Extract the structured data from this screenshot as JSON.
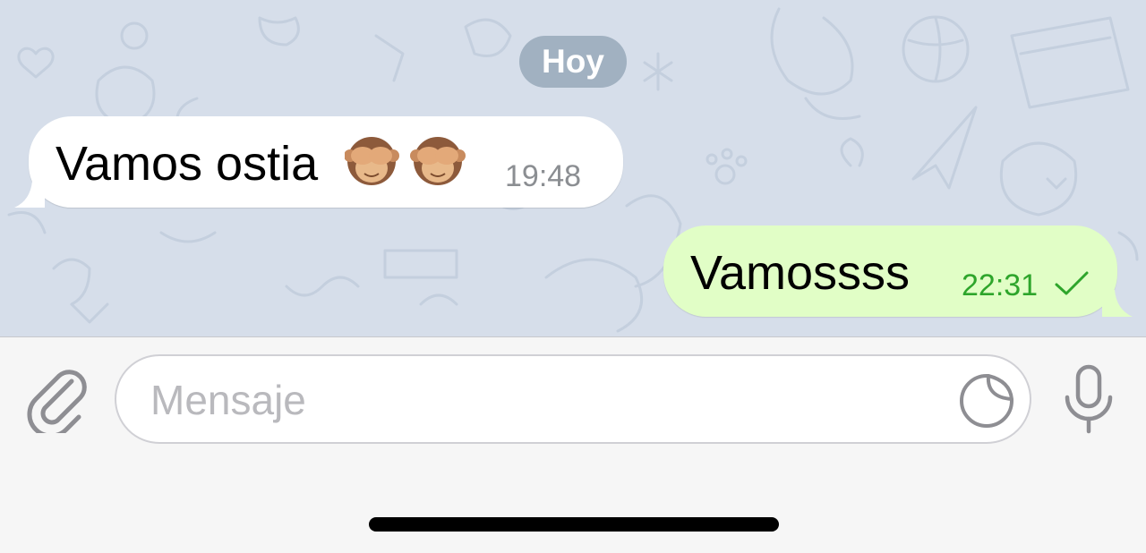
{
  "date_separator": "Hoy",
  "messages": [
    {
      "direction": "incoming",
      "text": "Vamos ostia",
      "emojis": [
        "see-no-evil-monkey",
        "see-no-evil-monkey"
      ],
      "time": "19:48"
    },
    {
      "direction": "outgoing",
      "text": "Vamossss",
      "time": "22:31",
      "status": "sent-checkmark"
    }
  ],
  "composer": {
    "placeholder": "Mensaje",
    "value": "",
    "attach_icon": "paperclip-icon",
    "sticker_icon": "sticker-icon",
    "mic_icon": "microphone-icon"
  },
  "colors": {
    "chat_background": "#d6deea",
    "incoming_bubble": "#ffffff",
    "outgoing_bubble": "#e1fec6",
    "outgoing_time": "#2ea52b",
    "incoming_time": "#8b8e92",
    "date_pill": "#8ca0b2"
  }
}
